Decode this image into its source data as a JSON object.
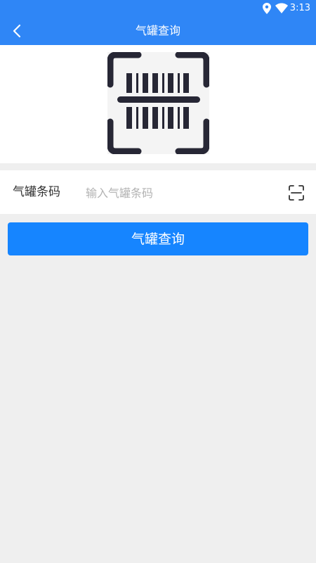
{
  "status_bar": {
    "time": "3:13",
    "icons": [
      "location-icon",
      "wifi-icon"
    ]
  },
  "app_bar": {
    "title": "气罐查询",
    "back_icon": "back-arrow-icon",
    "background": "#2f86f6"
  },
  "hero": {
    "icon": "barcode-scan-icon"
  },
  "form": {
    "label": "气罐条码",
    "input_value": "",
    "input_placeholder": "输入气罐条码",
    "scan_icon": "scan-icon"
  },
  "actions": {
    "query_label": "气罐查询",
    "button_color": "#1685ff"
  }
}
